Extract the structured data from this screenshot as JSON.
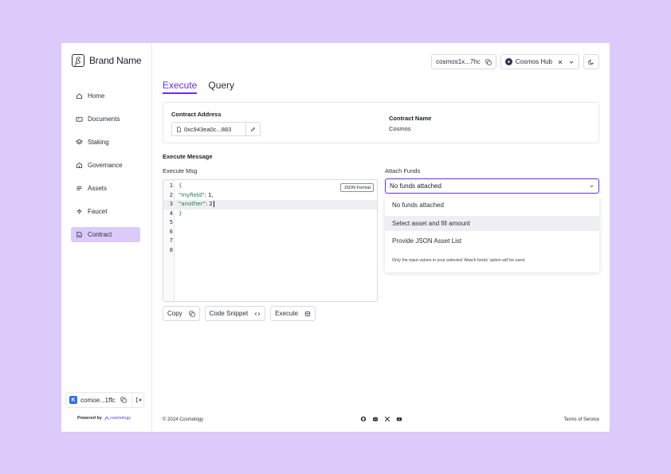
{
  "brand": {
    "name": "Brand Name"
  },
  "sidebar": {
    "items": [
      {
        "label": "Home",
        "icon": "home-icon"
      },
      {
        "label": "Documents",
        "icon": "documents-icon"
      },
      {
        "label": "Staking",
        "icon": "layers-icon"
      },
      {
        "label": "Governance",
        "icon": "governance-icon"
      },
      {
        "label": "Assets",
        "icon": "list-icon"
      },
      {
        "label": "Faucet",
        "icon": "faucet-icon"
      },
      {
        "label": "Contract",
        "icon": "contract-icon",
        "active": true
      }
    ],
    "wallet": {
      "badge": "K",
      "address": "comoe...1ffc"
    },
    "powered_by": "Powered by",
    "powered_brand": "cosmology"
  },
  "topbar": {
    "address": "cosmos1x...7hc",
    "chain": "Cosmos Hub"
  },
  "tabs": [
    "Execute",
    "Query"
  ],
  "contract": {
    "address_label": "Contract Address",
    "address": "0xc943ea0c...883",
    "name_label": "Contract Name",
    "name": "Cosmos"
  },
  "execute": {
    "title": "Execute Message",
    "msg_label": "Execute Msg",
    "json_format": "JSON Format",
    "lines": [
      "1",
      "2",
      "3",
      "4",
      "5",
      "6",
      "7",
      "8"
    ],
    "code": {
      "open": "{",
      "key1": "\"myfield\"",
      "val1": "1,",
      "key2": "\"another\"",
      "val2": "2",
      "close": "}",
      "colon": ": "
    },
    "actions": {
      "copy": "Copy",
      "snippet": "Code Snippet",
      "execute": "Execute"
    }
  },
  "funds": {
    "label": "Attach Funds",
    "selected": "No funds attached",
    "options": [
      "No funds attached",
      "Select asset and fill amount",
      "Provide JSON Asset List"
    ],
    "note": "Only the input values in your selected 'Attach funds' option will be used."
  },
  "footer": {
    "copyright": "© 2024 Cosmology",
    "terms": "Terms of Service"
  },
  "colors": {
    "accent": "#6a2ee8",
    "background": "#dccafb",
    "active_nav": "#dccafb"
  }
}
